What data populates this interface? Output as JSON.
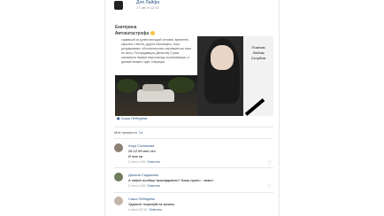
{
  "post": {
    "author": "Для Лайфа",
    "date": "17 авг в 12:02",
    "caption_line1": "Екатерина",
    "caption_line2": "Автокатастрофа",
    "photo_left_text": "сидевший за рулем молодой человек, временно скрылся с места, другие пассажиры, пока допрашивают, обстоятельства случившегося пока не ясны. Пострадавшую Денисову 3 раза оказывали первую мед помощь в реанимации, в данный момент идёт операция.",
    "photo_right_caption": [
      "Помним",
      "Любим",
      "Скорбим"
    ],
    "source": "Саша Лебедева"
  },
  "likes": {
    "label": "Мне нравится",
    "count": "14"
  },
  "comments": [
    {
      "name": "Анур Салимова",
      "text_line1": "26.12.99 или что",
      "text_line2": "И она на",
      "meta": "2 сен в 1:06",
      "reply": "Ответить"
    },
    {
      "name": "Диляна Садыкова",
      "text_line1": "А нафиг вообще выкладывать? Кому нужно - знают.",
      "meta": "2 сен в 1:06",
      "reply": "Ответить"
    },
    {
      "name": "Саша Лебедева",
      "text_line1": "Удалите пожалуйста запись.",
      "meta": "4 сен в 23:15",
      "reply": "Ответить"
    }
  ],
  "icons": {
    "like": "heart-icon",
    "emoji": "sad-face-emoji"
  }
}
